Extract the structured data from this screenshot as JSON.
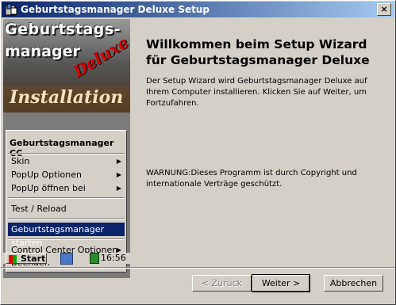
{
  "window": {
    "title": "Geburtstagsmanager Deluxe Setup",
    "close_label": "×"
  },
  "banner": {
    "line1": "Geburtstags-",
    "line2": "manager",
    "deluxe": "Deluxe",
    "install": "Installation"
  },
  "context_menu": {
    "header": "Geburtstagsmanager CC",
    "items": [
      {
        "label": "Skin",
        "submenu": true
      },
      {
        "label": "PopUp Optionen",
        "submenu": true
      },
      {
        "label": "PopUp öffnen bei",
        "submenu": true
      },
      {
        "label": "Test / Reload",
        "submenu": false
      },
      {
        "label": "Geburtstagsmanager starten",
        "submenu": false,
        "highlighted": true
      },
      {
        "label": "Control Center Optionen",
        "submenu": true
      },
      {
        "label": "Beenden",
        "submenu": false
      }
    ],
    "arrow_glyph": "▶"
  },
  "taskbar": {
    "start_label": "Start",
    "clock": "16:56"
  },
  "content": {
    "heading": "Willkommen beim Setup Wizard für Geburtstagsmanager Deluxe",
    "intro": "Der Setup Wizard wird Geburtstagsmanager Deluxe auf Ihrem Computer installieren.  Klicken Sie auf Weiter, um Fortzufahren.",
    "warning": "WARNUNG:Dieses Programm ist durch Copyright und internationale Verträge geschützt."
  },
  "buttons": {
    "back": "< Zurück",
    "next": "Weiter >",
    "cancel": "Abbrechen"
  },
  "colors": {
    "titlebar_start": "#0a246a",
    "titlebar_end": "#a6caf0",
    "face": "#d4d0c8",
    "highlight": "#0a246a"
  }
}
